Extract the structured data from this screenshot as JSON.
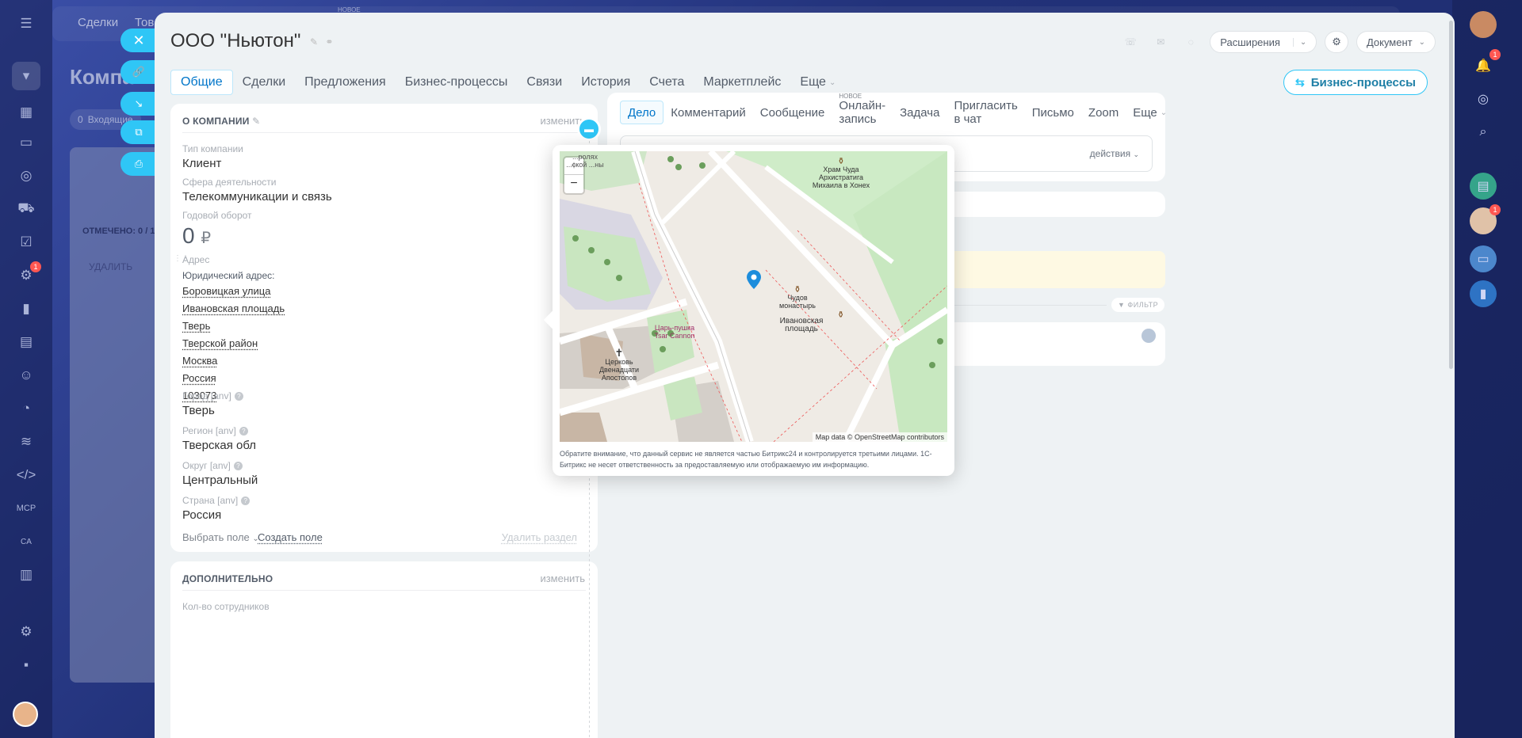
{
  "underlay": {
    "nav_items": [
      "Сделки",
      "Тов"
    ],
    "title": "Компа",
    "incoming": "Входящие",
    "incoming_count": "0",
    "marked": "ОТМЕЧЕНО: 0 / 1",
    "delete": "УДАЛИТЬ",
    "new_label": "НОВОЕ"
  },
  "company": {
    "title": "ООО \"Ньютон\""
  },
  "toolbar": {
    "extensions": "Расширения",
    "document": "Документ"
  },
  "tabs": [
    "Общие",
    "Сделки",
    "Предложения",
    "Бизнес-процессы",
    "Связи",
    "История",
    "Счета",
    "Маркетплейс",
    "Еще"
  ],
  "bp_button": "Бизнес-процессы",
  "about": {
    "header": "О КОМПАНИИ",
    "edit": "изменить",
    "type_label": "Тип компании",
    "type_value": "Клиент",
    "industry_label": "Сфера деятельности",
    "industry_value": "Телекоммуникации и связь",
    "revenue_label": "Годовой оборот",
    "revenue_value": "0",
    "revenue_currency": "₽",
    "address_label": "Адрес",
    "legal_address_label": "Юридический адрес:",
    "address_lines": [
      "Боровицкая улица",
      "Ивановская площадь",
      "Тверь",
      "Тверской район",
      "Москва",
      "Россия",
      "103073"
    ],
    "city_label": "Город [anv]",
    "city_value": "Тверь",
    "region_label": "Регион [anv]",
    "region_value": "Тверская обл",
    "district_label": "Округ [anv]",
    "district_value": "Центральный",
    "country_label": "Страна [anv]",
    "country_value": "Россия",
    "select_field": "Выбрать поле",
    "create_field": "Создать поле",
    "delete_section": "Удалить раздел"
  },
  "additional": {
    "header": "ДОПОЛНИТЕЛЬНО",
    "edit": "изменить",
    "employees_label": "Кол-во сотрудников"
  },
  "activity": {
    "tabs": [
      "Дело",
      "Комментарий",
      "Сообщение",
      "Онлайн-запись",
      "Задача",
      "Пригласить в чат",
      "Письмо",
      "Zoom",
      "Еще"
    ],
    "new_label": "НОВОЕ",
    "actions": "действия",
    "filter": "ФИЛЬТР"
  },
  "map": {
    "labels": {
      "church_top": "Храм Чуда Архистратига Михаила в Хонех",
      "chudov": "Чудов монастырь",
      "ivanovskaya": "Ивановская площадь",
      "tsar_cannon": "Царь-пушка Tsar Cannon",
      "twelve_apostles": "Церковь Двенадцати Апостолов",
      "patriarch": "...ролях ...ской ...ны"
    },
    "attribution": "Map data © OpenStreetMap contributors",
    "zoom_in": "+",
    "zoom_out": "−",
    "notice": "Обратите внимание, что данный сервис не является частью Битрикс24 и контролируется третьими лицами. 1С-Битрикс не несет ответственность за предоставляемую или отображаемую им информацию."
  },
  "right_nav": {
    "badges": [
      "1",
      "1"
    ]
  },
  "left_nav": {
    "badge": "1",
    "labels": [
      "MCP",
      "CA"
    ]
  }
}
